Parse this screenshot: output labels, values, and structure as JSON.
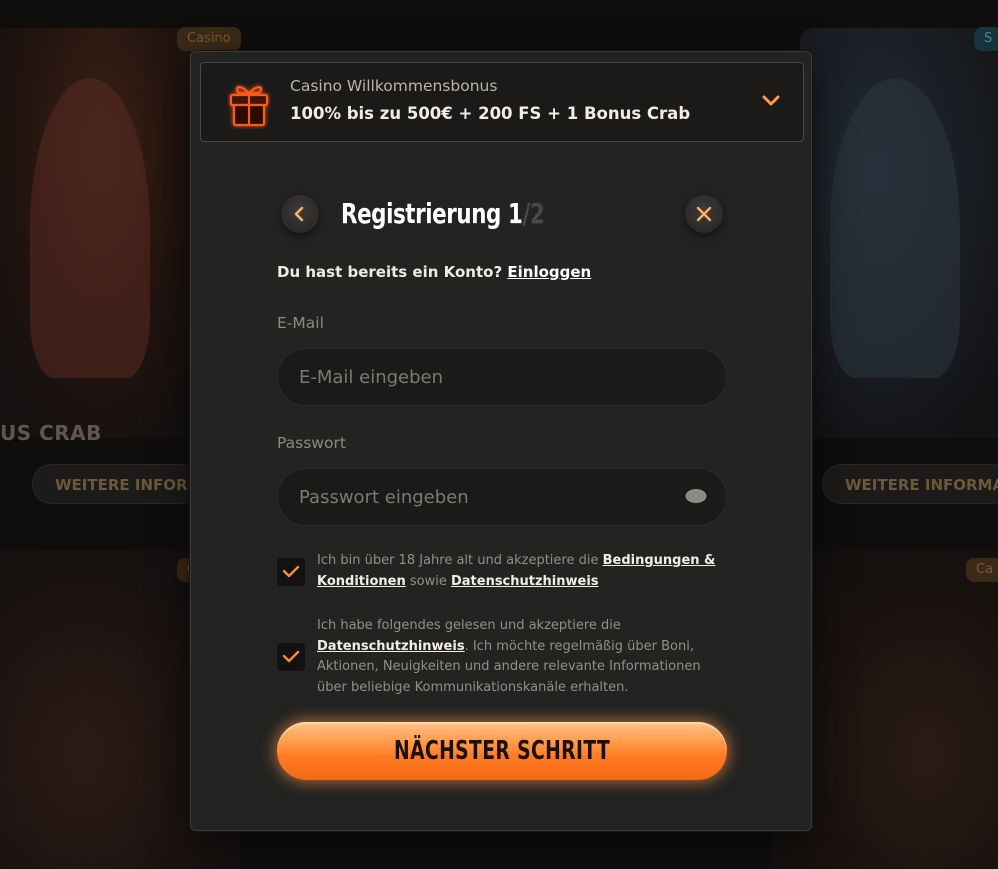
{
  "background": {
    "tag_left": "Casino",
    "tag_right": "S",
    "tag_mid_left": "C",
    "tag_mid_right": "Ca",
    "label_left": "US CRAB",
    "more_info_left": "WEITERE INFORMATIO",
    "more_info_right": "WEITERE INFORMATIONE"
  },
  "bonus": {
    "title": "Casino Willkommensbonus",
    "text": "100% bis zu 500€ + 200 FS + 1 Bonus Crab",
    "icon": "gift-icon"
  },
  "header": {
    "title": "Registrierung 1",
    "step_total": "/2",
    "back_icon": "chevron-left-icon",
    "close_icon": "close-icon"
  },
  "login": {
    "prompt": "Du hast bereits ein Konto? ",
    "link": "Einloggen"
  },
  "form": {
    "email_label": "E-Mail",
    "email_placeholder": "E-Mail eingeben",
    "email_value": "",
    "password_label": "Passwort",
    "password_placeholder": "Passwort eingeben",
    "password_value": ""
  },
  "consent": {
    "age_checked": true,
    "age_text": "Ich bin über 18 Jahre alt und akzeptiere die ",
    "age_terms_link": "Bedingungen & Konditionen",
    "age_and": " sowie ",
    "age_privacy_link": "Datenschutzhinweis",
    "marketing_checked": true,
    "marketing_text_1": "Ich habe folgendes gelesen und akzeptiere die ",
    "marketing_privacy_link": "Datenschutzhinweis",
    "marketing_text_2": ". Ich möchte regelmäßig über Boni, Aktionen, Neuigkeiten und andere relevante Informationen über beliebige Kommunikationskanäle erhalten."
  },
  "next_button": "NÄCHSTER SCHRITT",
  "colors": {
    "accent": "#ff8a35",
    "modal_bg": "#232322",
    "page_bg": "#0f0e0d"
  }
}
